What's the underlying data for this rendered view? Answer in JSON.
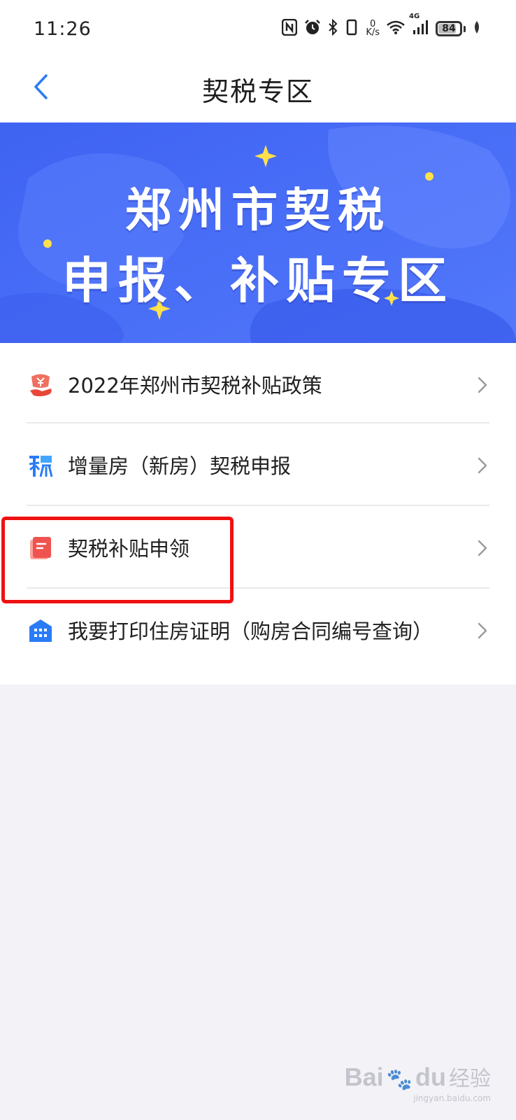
{
  "status_bar": {
    "time": "11:26",
    "net_speed_value": "0",
    "net_speed_unit": "K/s",
    "network_type": "4G",
    "battery_level": "84",
    "battery_fraction": 0.84,
    "icons": [
      "nfc-icon",
      "alarm-icon",
      "bluetooth-icon",
      "vibrate-icon",
      "wifi-icon",
      "signal-icon",
      "battery-icon",
      "leaf-icon"
    ]
  },
  "nav": {
    "title": "契税专区",
    "back_icon": "chevron-left-icon"
  },
  "banner": {
    "line1": "郑州市契税",
    "line2": "申报、补贴专区"
  },
  "menu": {
    "items": [
      {
        "label": "2022年郑州市契税补贴政策",
        "icon": "subsidy-coin-icon"
      },
      {
        "label": "增量房（新房）契税申报",
        "icon": "tax-declare-icon"
      },
      {
        "label": "契税补贴申领",
        "icon": "document-red-icon",
        "highlighted": true
      },
      {
        "label": "我要打印住房证明（购房合同编号查询）",
        "icon": "building-icon"
      }
    ]
  },
  "colors": {
    "accent_blue": "#2a7cf6",
    "banner_blue": "#4a6cf7",
    "highlight_red": "#ee1111",
    "page_bg": "#f2f2f7"
  },
  "watermark": {
    "brand": "Bai",
    "brand2": "du",
    "text": "经验",
    "url": "jingyan.baidu.com"
  }
}
